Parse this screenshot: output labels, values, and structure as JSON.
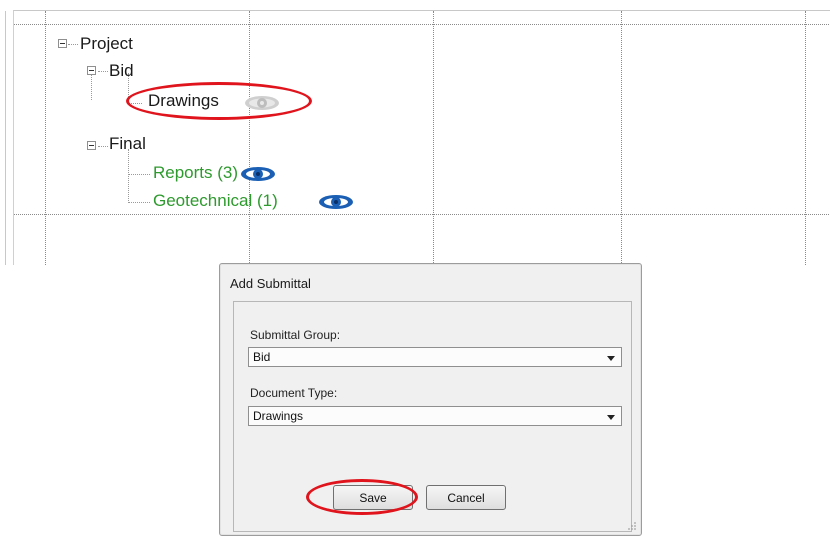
{
  "tree": {
    "nodes": {
      "project": "Project",
      "bid": "Bid",
      "drawings": "Drawings",
      "final": "Final",
      "reports": "Reports (3)",
      "geotechnical": "Geotechnical (1)"
    },
    "icons": {
      "drawings_eye": "eye-icon-gray",
      "reports_eye": "eye-icon-blue",
      "geotechnical_eye": "eye-icon-blue"
    },
    "colors": {
      "green_text": "#2e9a2e",
      "eye_blue": "#1a5fb4",
      "eye_gray": "#bdbdbd",
      "highlight": "#e0141c"
    }
  },
  "dialog": {
    "title": "Add Submittal",
    "submittal_group_label": "Submittal Group:",
    "submittal_group_value": "Bid",
    "document_type_label": "Document Type:",
    "document_type_value": "Drawings",
    "save_label": "Save",
    "cancel_label": "Cancel"
  }
}
